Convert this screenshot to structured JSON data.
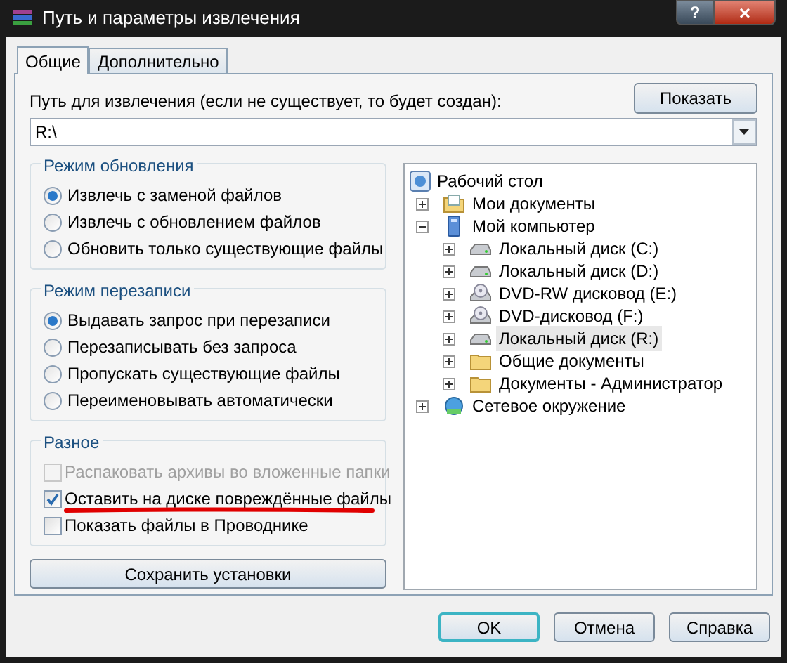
{
  "window": {
    "title": "Путь и параметры извлечения",
    "buttons": [
      {
        "kind": "help",
        "label": "?"
      },
      {
        "kind": "close",
        "label": "×"
      }
    ]
  },
  "tabs": [
    {
      "label": "Общие",
      "selected": true
    },
    {
      "label": "Дополнительно",
      "selected": false
    }
  ],
  "path": {
    "label": "Путь для извлечения (если не существует, то будет создан):",
    "value": "R:\\",
    "show_button": "Показать"
  },
  "update_mode": {
    "title": "Режим обновления",
    "options": [
      {
        "label": "Извлечь с заменой файлов",
        "selected": true
      },
      {
        "label": "Извлечь с обновлением файлов",
        "selected": false
      },
      {
        "label": "Обновить только существующие файлы",
        "selected": false
      }
    ]
  },
  "overwrite_mode": {
    "title": "Режим перезаписи",
    "options": [
      {
        "label": "Выдавать запрос при перезаписи",
        "selected": true
      },
      {
        "label": "Перезаписывать без запроса",
        "selected": false
      },
      {
        "label": "Пропускать существующие файлы",
        "selected": false
      },
      {
        "label": "Переименовывать автоматически",
        "selected": false
      }
    ]
  },
  "misc": {
    "title": "Разное",
    "options": [
      {
        "label": "Распаковать архивы во вложенные папки",
        "checked": false,
        "disabled": true,
        "underlined": false
      },
      {
        "label": "Оставить на диске повреждённые файлы",
        "checked": true,
        "disabled": false,
        "underlined": true
      },
      {
        "label": "Показать файлы в Проводнике",
        "checked": false,
        "disabled": false,
        "underlined": false
      }
    ]
  },
  "save_button": "Сохранить установки",
  "tree": {
    "root": {
      "label": "Рабочий стол",
      "kind": "desktop"
    },
    "items": [
      {
        "label": "Мои документы",
        "kind": "documents",
        "expanded": false,
        "selected": false
      },
      {
        "label": "Мой компьютер",
        "kind": "computer",
        "expanded": true,
        "selected": false,
        "children": [
          {
            "label": "Локальный диск (C:)",
            "kind": "drive",
            "expanded": false,
            "selected": false
          },
          {
            "label": "Локальный диск (D:)",
            "kind": "drive",
            "expanded": false,
            "selected": false
          },
          {
            "label": "DVD-RW дисковод (E:)",
            "kind": "dvd",
            "expanded": false,
            "selected": false
          },
          {
            "label": "DVD-дисковод (F:)",
            "kind": "dvd",
            "expanded": false,
            "selected": false
          },
          {
            "label": "Локальный диск (R:)",
            "kind": "drive",
            "expanded": false,
            "selected": true
          },
          {
            "label": "Общие документы",
            "kind": "folder",
            "expanded": false,
            "selected": false
          },
          {
            "label": "Документы - Администратор",
            "kind": "folder",
            "expanded": false,
            "selected": false
          }
        ]
      },
      {
        "label": "Сетевое окружение",
        "kind": "network",
        "expanded": false,
        "selected": false
      }
    ]
  },
  "footer_buttons": [
    {
      "label": "OK",
      "selected": true
    },
    {
      "label": "Отмена",
      "selected": false
    },
    {
      "label": "Справка",
      "selected": false
    }
  ]
}
